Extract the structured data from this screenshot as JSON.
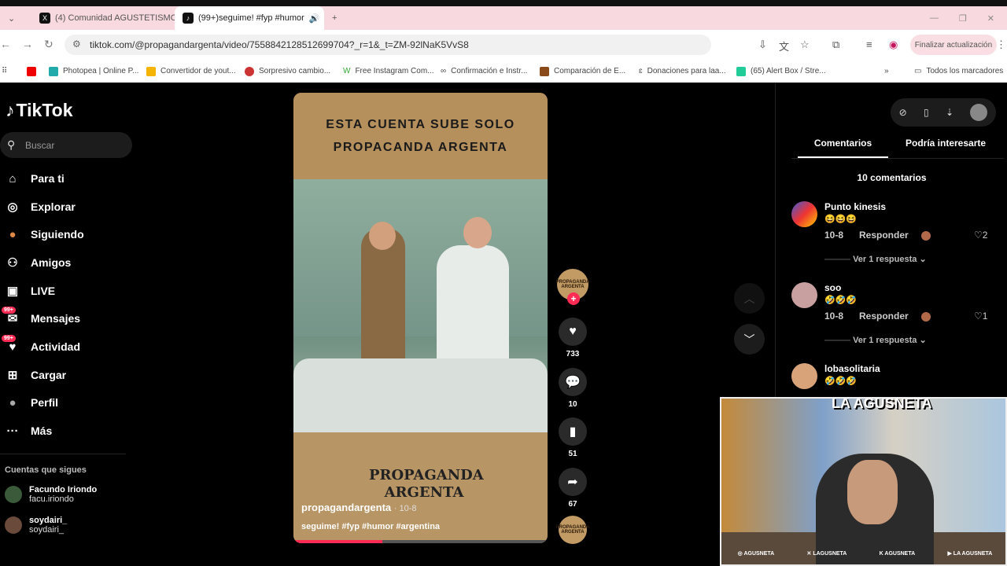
{
  "browser": {
    "tabs": [
      {
        "title": "(4) Comunidad AGUSTETISMO",
        "icon": "X"
      },
      {
        "title": "(99+)seguime! #fyp #humor",
        "icon": "♪"
      }
    ],
    "url": "tiktok.com/@propagandargenta/video/7558842128512699704?_r=1&_t=ZM-92lNaK5VvS8",
    "update_button": "Finalizar actualización",
    "bookmarks": [
      "Photopea | Online P...",
      "Convertidor de yout...",
      "Sorpresivo cambio...",
      "Free Instagram Com...",
      "Confirmación e Instr...",
      "Comparación de E...",
      "Donaciones para laa...",
      "(65) Alert Box / Stre..."
    ],
    "all_bookmarks": "Todos los marcadores"
  },
  "sidebar": {
    "logo": "TikTok",
    "search_placeholder": "Buscar",
    "nav": [
      {
        "label": "Para ti",
        "icon": "home-icon",
        "glyph": "⌂"
      },
      {
        "label": "Explorar",
        "icon": "compass-icon",
        "glyph": "◎"
      },
      {
        "label": "Siguiendo",
        "icon": "avatar-icon",
        "glyph": "●"
      },
      {
        "label": "Amigos",
        "icon": "friends-icon",
        "glyph": "⚇"
      },
      {
        "label": "LIVE",
        "icon": "live-icon",
        "glyph": "▣"
      },
      {
        "label": "Mensajes",
        "icon": "message-icon",
        "glyph": "✉",
        "badge": "99+"
      },
      {
        "label": "Actividad",
        "icon": "activity-icon",
        "glyph": "♥",
        "badge": "99+"
      },
      {
        "label": "Cargar",
        "icon": "upload-icon",
        "glyph": "⊞"
      },
      {
        "label": "Perfil",
        "icon": "profile-icon",
        "glyph": "●"
      },
      {
        "label": "Más",
        "icon": "more-icon",
        "glyph": "···"
      }
    ],
    "following_heading": "Cuentas que sigues",
    "following": [
      {
        "name": "Facundo Iriondo",
        "handle": "facu.iriondo"
      },
      {
        "name": "soydairi_",
        "handle": "soydairi_"
      }
    ]
  },
  "video": {
    "headline_line1": "ESTA CUENTA SUBE SOLO",
    "headline_line2": "PROPACANDA ARGENTA",
    "logo_line1": "PROPAGANDA",
    "logo_line2": "ARGENTA",
    "username": "propagandargenta",
    "date": "· 10-8",
    "caption": "seguime! #fyp #humor #argentina",
    "progress": 0.35
  },
  "actions": {
    "avatar_text": "PROPAGANDA ARGENTA",
    "likes": "733",
    "comments": "10",
    "saves": "51",
    "shares": "67"
  },
  "comments_panel": {
    "tab_comments": "Comentarios",
    "tab_interest": "Podría interesarte",
    "count": "10 comentarios",
    "items": [
      {
        "name": "Punto kinesis",
        "emoji": "😆😆😆",
        "date": "10-8",
        "reply": "Responder",
        "likes": "2",
        "more": "Ver 1 respuesta ⌄",
        "color": "#3b5bd6"
      },
      {
        "name": "soo",
        "emoji": "🤣🤣🤣",
        "date": "10-8",
        "reply": "Responder",
        "likes": "1",
        "more": "Ver 1 respuesta ⌄",
        "color": "#c9a0a0"
      },
      {
        "name": "lobasolitaria",
        "emoji": "🤣🤣🤣",
        "date": "",
        "reply": "",
        "likes": "",
        "more": "",
        "color": "#d9a37a"
      }
    ]
  },
  "webcam": {
    "logo": "LA AGUSNETA",
    "socials": [
      "AGUSNETA",
      "LAGUSNETA",
      "AGUSNETA",
      "LA AGUSNETA"
    ]
  }
}
